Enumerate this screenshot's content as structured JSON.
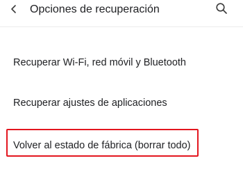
{
  "header": {
    "title": "Opciones de recuperación",
    "back_icon": "chevron-left-icon",
    "search_icon": "search-icon"
  },
  "menu": {
    "items": [
      {
        "label": "Recuperar Wi-Fi, red móvil y Bluetooth"
      },
      {
        "label": "Recuperar ajustes de aplicaciones"
      },
      {
        "label": "Volver al estado de fábrica (borrar todo)"
      }
    ]
  },
  "highlight": {
    "color": "#e3161f"
  }
}
